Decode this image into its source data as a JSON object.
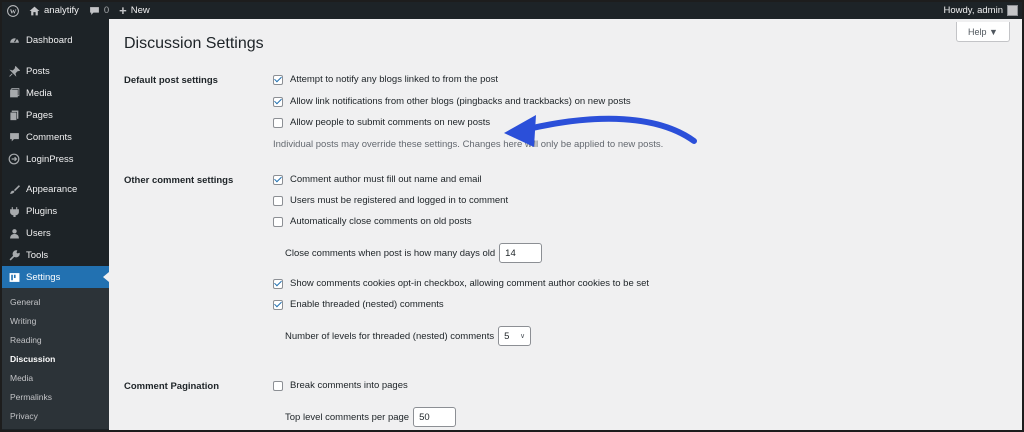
{
  "admin_bar": {
    "site_name": "analytify",
    "comments_count": "0",
    "new_label": "New",
    "howdy": "Howdy, admin"
  },
  "sidebar": {
    "items": [
      {
        "label": "Dashboard",
        "icon": "dashboard-icon"
      },
      {
        "label": "Posts",
        "icon": "pin-icon"
      },
      {
        "label": "Media",
        "icon": "media-icon"
      },
      {
        "label": "Pages",
        "icon": "pages-icon"
      },
      {
        "label": "Comments",
        "icon": "comment-icon"
      },
      {
        "label": "LoginPress",
        "icon": "loginpress-icon"
      },
      {
        "label": "Appearance",
        "icon": "brush-icon"
      },
      {
        "label": "Plugins",
        "icon": "plug-icon"
      },
      {
        "label": "Users",
        "icon": "user-icon"
      },
      {
        "label": "Tools",
        "icon": "wrench-icon"
      },
      {
        "label": "Settings",
        "icon": "settings-icon"
      }
    ],
    "submenu": [
      "General",
      "Writing",
      "Reading",
      "Discussion",
      "Media",
      "Permalinks",
      "Privacy"
    ],
    "current_sub": "Discussion"
  },
  "help_label": "Help ▼",
  "page_title": "Discussion Settings",
  "sections": {
    "default_post": {
      "label": "Default post settings",
      "opt1": "Attempt to notify any blogs linked to from the post",
      "opt2": "Allow link notifications from other blogs (pingbacks and trackbacks) on new posts",
      "opt3": "Allow people to submit comments on new posts",
      "desc": "Individual posts may override these settings. Changes here will only be applied to new posts."
    },
    "other_comment": {
      "label": "Other comment settings",
      "opt1": "Comment author must fill out name and email",
      "opt2": "Users must be registered and logged in to comment",
      "opt3": "Automatically close comments on old posts",
      "close_days_label": "Close comments when post is how many days old",
      "close_days_value": "14",
      "opt4": "Show comments cookies opt-in checkbox, allowing comment author cookies to be set",
      "opt5": "Enable threaded (nested) comments",
      "levels_label": "Number of levels for threaded (nested) comments",
      "levels_value": "5"
    },
    "pagination": {
      "label": "Comment Pagination",
      "opt1": "Break comments into pages",
      "per_page_label": "Top level comments per page",
      "per_page_value": "50"
    }
  },
  "colors": {
    "admin_dark": "#1d2327",
    "accent_blue": "#2271b1",
    "arrow_blue": "#2b4fd9",
    "content_bg": "#f0f0f1"
  }
}
